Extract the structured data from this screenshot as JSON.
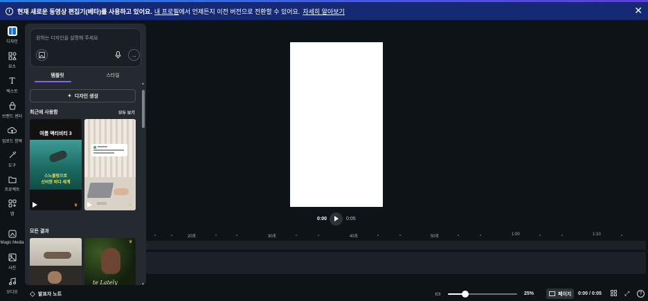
{
  "banner": {
    "info_icon": "info-icon",
    "message": "현재 새로운 동영상 편집기(베타)를 사용하고 있어요.",
    "link_profile": "내 프로필",
    "message_tail": "에서 언제든지 이전 버전으로 전환할 수 있어요.",
    "link_more": "자세히 알아보기",
    "close_icon": "close-icon"
  },
  "sidebar": {
    "items": [
      {
        "label": "디자인",
        "icon": "design-icon",
        "active": true
      },
      {
        "label": "요소",
        "icon": "elements-icon"
      },
      {
        "label": "텍스트",
        "icon": "text-icon"
      },
      {
        "label": "브랜드 센터",
        "icon": "brand-icon"
      },
      {
        "label": "업로드 항목",
        "icon": "upload-icon"
      },
      {
        "label": "도구",
        "icon": "tools-icon"
      },
      {
        "label": "프로젝트",
        "icon": "folder-icon"
      },
      {
        "label": "앱",
        "icon": "apps-icon"
      },
      {
        "label": "Magic Media",
        "icon": "magic-media-icon"
      },
      {
        "label": "사진",
        "icon": "photos-icon"
      },
      {
        "label": "오디오",
        "icon": "audio-icon"
      }
    ]
  },
  "panel": {
    "prompt_placeholder": "원하는 디자인을 설명해 주세요",
    "tabs": [
      {
        "label": "템플릿",
        "active": true
      },
      {
        "label": "스타일"
      }
    ],
    "generate_button": "디자인 생성",
    "recent_title": "최근에 사용함",
    "see_all": "모두 보기",
    "results_title": "모든 결과",
    "template1": {
      "title": "여름 액티비티 3",
      "caption1": "스노클링으로",
      "caption2": "신비한 바다 세계"
    },
    "template4": {
      "text": "te Lately"
    }
  },
  "player": {
    "current": "0:00",
    "duration": "0:05"
  },
  "timeline": {
    "ticks": [
      "20초",
      "30초",
      "40초",
      "50초",
      "1:00",
      "1:10"
    ]
  },
  "bottombar": {
    "notes": "발표자 노트",
    "zoom_percent": 25,
    "zoom": "25%",
    "pages": "페이지",
    "time": "0:00 / 0:05"
  },
  "colors": {
    "banner_bg": "#162a73",
    "accent": "#8a63f2",
    "background": "#0e1318",
    "panel": "#252a31"
  }
}
